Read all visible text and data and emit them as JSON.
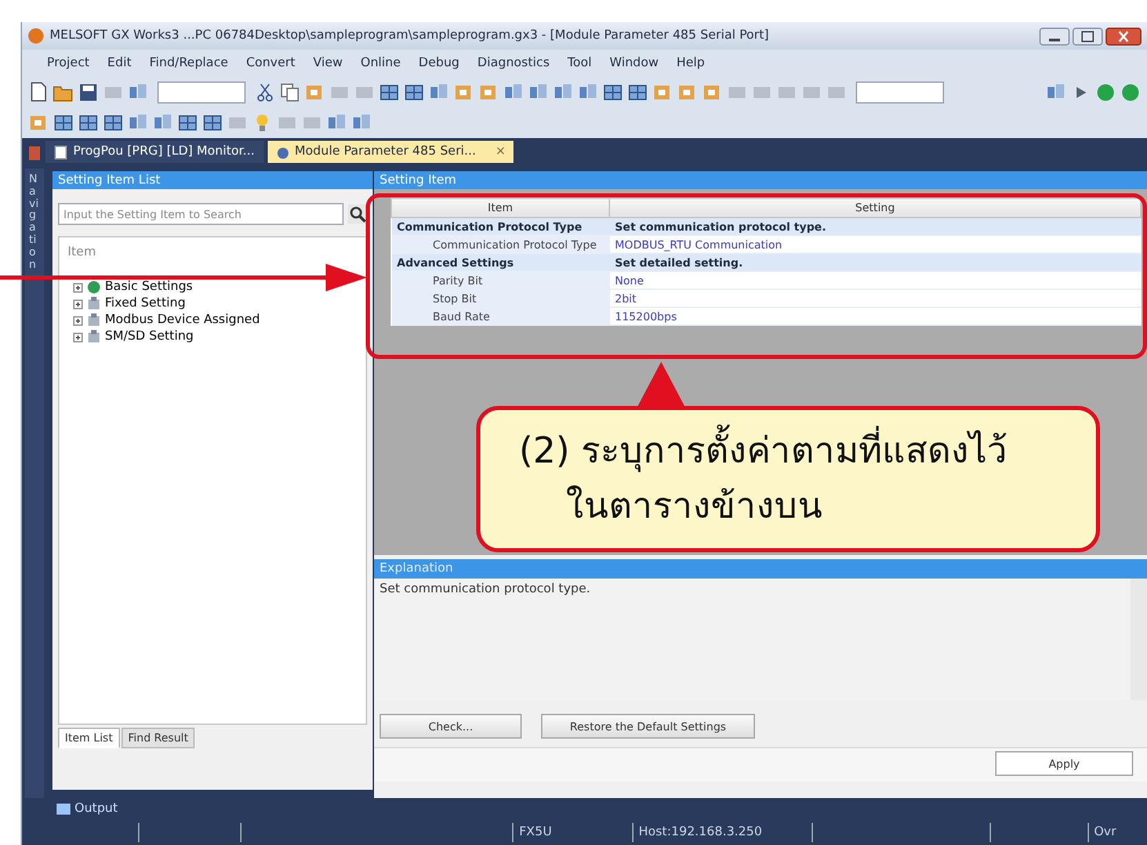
{
  "window": {
    "title": "MELSOFT GX Works3 ...PC 06784Desktop\\sampleprogram\\sampleprogram.gx3 - [Module Parameter 485 Serial Port]"
  },
  "menu": [
    "Project",
    "Edit",
    "Find/Replace",
    "Convert",
    "View",
    "Online",
    "Debug",
    "Diagnostics",
    "Tool",
    "Window",
    "Help"
  ],
  "doc_tabs": [
    {
      "label": "ProgPou [PRG] [LD] Monitor...",
      "selected": false
    },
    {
      "label": "Module Parameter 485 Seri...",
      "selected": true,
      "close": "×"
    }
  ],
  "navigation": {
    "label": "Navigation"
  },
  "item_list": {
    "title": "Setting Item List",
    "search": {
      "placeholder": "Input the Setting Item to Search"
    },
    "header": "Item",
    "tree": [
      {
        "label": "Basic Settings",
        "kind": "basic"
      },
      {
        "label": "Fixed Setting",
        "kind": "plain"
      },
      {
        "label": "Modbus Device Assigned",
        "kind": "plain"
      },
      {
        "label": "SM/SD Setting",
        "kind": "plain"
      }
    ],
    "tabs": [
      {
        "label": "Item List",
        "selected": true
      },
      {
        "label": "Find Result",
        "selected": false
      }
    ]
  },
  "settings": {
    "title": "Setting Item",
    "columns": [
      "Item",
      "Setting"
    ],
    "rows": [
      {
        "kind": "group",
        "item": "Communication Protocol Type",
        "setting": "Set communication protocol type."
      },
      {
        "kind": "value",
        "item": "Communication Protocol Type",
        "setting": "MODBUS_RTU Communication"
      },
      {
        "kind": "group",
        "item": "Advanced Settings",
        "setting": "Set detailed setting."
      },
      {
        "kind": "value",
        "item": "Parity Bit",
        "setting": "None"
      },
      {
        "kind": "value",
        "item": "Stop Bit",
        "setting": "2bit"
      },
      {
        "kind": "value",
        "item": "Baud Rate",
        "setting": "115200bps"
      }
    ]
  },
  "explanation": {
    "title": "Explanation",
    "text": "Set communication protocol type."
  },
  "buttons": [
    "Check...",
    "Restore the Default Settings"
  ],
  "apply": "Apply",
  "output": {
    "label": "Output"
  },
  "status_bar": [
    "FX5U",
    "Host:192.168.3.250",
    "Ovr"
  ],
  "callout": {
    "lines": [
      "(2) ระบุการตั้งค่าตามที่แสดงไว้",
      "ในตารางข้างบน"
    ]
  }
}
